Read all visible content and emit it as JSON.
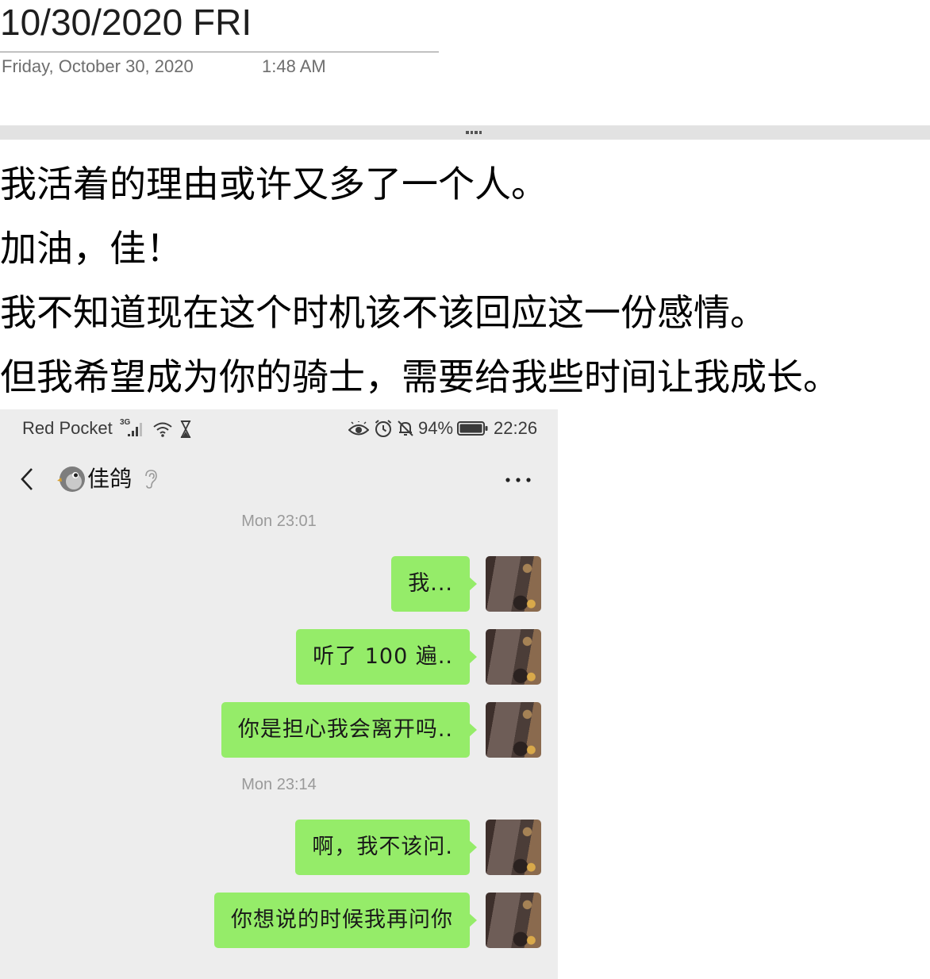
{
  "page": {
    "title": "10/30/2020 FRI",
    "date": "Friday, October 30, 2020",
    "time": "1:48 AM",
    "lines": [
      "我活着的理由或许又多了一个人。",
      "加油，佳！",
      "我不知道现在这个时机该不该回应这一份感情。",
      "但我希望成为你的骑士，需要给我些时间让我成长。"
    ]
  },
  "screenshot": {
    "status_bar": {
      "carrier": "Red Pocket",
      "network_type": "3G",
      "battery": "94%",
      "time": "22:26",
      "icons": [
        "signal-icon",
        "wifi-icon",
        "hourglass-icon",
        "eye-icon",
        "alarm-icon",
        "bell-off-icon",
        "battery-icon"
      ]
    },
    "header": {
      "contact_name": "佳鸽",
      "icons": [
        "chevron-left-icon",
        "bird-avatar-icon",
        "ear-icon",
        "more-icon"
      ]
    },
    "chat": [
      {
        "timestamp": "Mon 23:01",
        "messages": [
          {
            "text": "我..."
          },
          {
            "text": "听了 100 遍.."
          },
          {
            "text": "你是担心我会离开吗.."
          }
        ]
      },
      {
        "timestamp": "Mon 23:14",
        "messages": [
          {
            "text": "啊，我不该问."
          },
          {
            "text": "你想说的时候我再问你"
          }
        ]
      }
    ]
  },
  "colors": {
    "chat_bubble": "#95ec69",
    "chat_background": "#ededed",
    "container_bar": "#e2e2e2",
    "date_text": "#6e6e6e"
  }
}
